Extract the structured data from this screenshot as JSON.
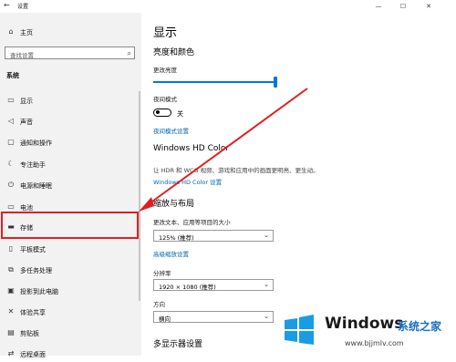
{
  "window": {
    "title": "设置",
    "back_glyph": "←"
  },
  "controls": {
    "minimize": "—",
    "maximize": "☐",
    "close": "✕"
  },
  "sidebar": {
    "home": "主页",
    "search_placeholder": "查找设置",
    "section": "系统",
    "items": [
      {
        "label": "显示",
        "icon": "monitor-icon"
      },
      {
        "label": "声音",
        "icon": "speaker-icon"
      },
      {
        "label": "通知和操作",
        "icon": "notification-icon"
      },
      {
        "label": "专注助手",
        "icon": "moon-icon"
      },
      {
        "label": "电源和睡眠",
        "icon": "power-icon"
      },
      {
        "label": "电池",
        "icon": "battery-icon"
      },
      {
        "label": "存储",
        "icon": "storage-icon"
      },
      {
        "label": "平板模式",
        "icon": "tablet-icon"
      },
      {
        "label": "多任务处理",
        "icon": "multitask-icon"
      },
      {
        "label": "投影到此电脑",
        "icon": "project-icon"
      },
      {
        "label": "体验共享",
        "icon": "share-icon"
      },
      {
        "label": "剪贴板",
        "icon": "clipboard-icon"
      },
      {
        "label": "远程桌面",
        "icon": "remote-icon"
      }
    ]
  },
  "main": {
    "page_title": "显示",
    "brightness_heading": "亮度和颜色",
    "brightness_label": "更改亮度",
    "brightness_value": 1.0,
    "night_label": "夜间模式",
    "night_state": "关",
    "night_settings_link": "夜间模式设置",
    "hd_heading": "Windows HD Color",
    "hd_desc": "让 HDR 和 WCG 视频、游戏和应用中的画面更明亮、更生动。",
    "hd_link": "Windows HD Color 设置",
    "scale_heading": "缩放与布局",
    "scale_label": "更改文本、应用等项目的大小",
    "scale_value": "125% (推荐)",
    "advanced_scale_link": "高级缩放设置",
    "resolution_label": "分辨率",
    "resolution_value": "1920 × 1080 (推荐)",
    "orientation_label": "方向",
    "orientation_value": "横向",
    "multi_heading": "多显示器设置"
  },
  "watermark": {
    "brand": "Windows",
    "cn": "系统之家",
    "url": "www.bjjmlv.com"
  },
  "colors": {
    "accent": "#0078d7",
    "highlight": "#e02020",
    "sidebar_bg": "#f2f2f2"
  }
}
